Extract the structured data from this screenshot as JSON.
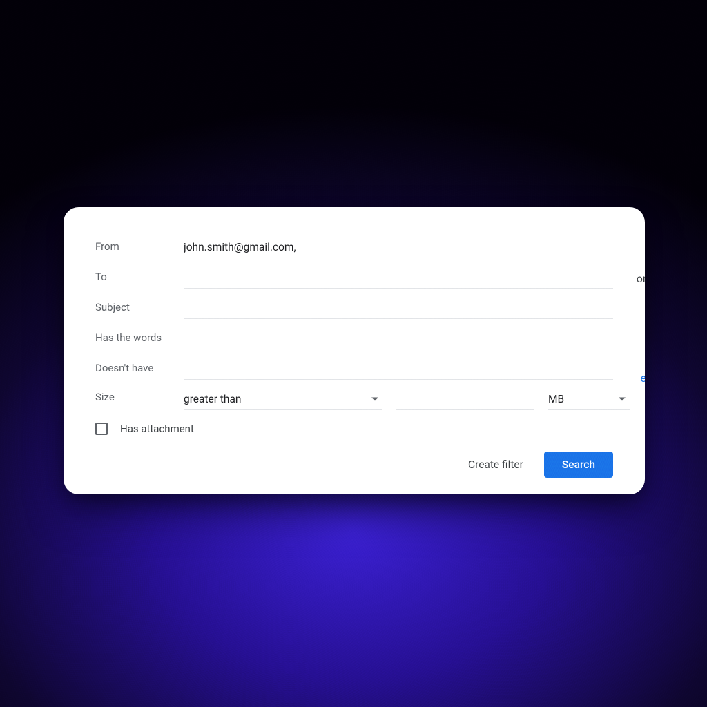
{
  "filter": {
    "from_label": "From",
    "from_value": "john.smith@gmail.com,",
    "to_label": "To",
    "to_value": "",
    "subject_label": "Subject",
    "subject_value": "",
    "has_words_label": "Has the words",
    "has_words_value": "",
    "doesnt_have_label": "Doesn't have",
    "doesnt_have_value": "",
    "size_label": "Size",
    "size_comparator": "greater than",
    "size_value": "",
    "size_unit": "MB",
    "has_attachment_label": "Has attachment"
  },
  "actions": {
    "create_filter": "Create filter",
    "search": "Search"
  },
  "peek": {
    "line1": "ons",
    "line2": "ew"
  }
}
